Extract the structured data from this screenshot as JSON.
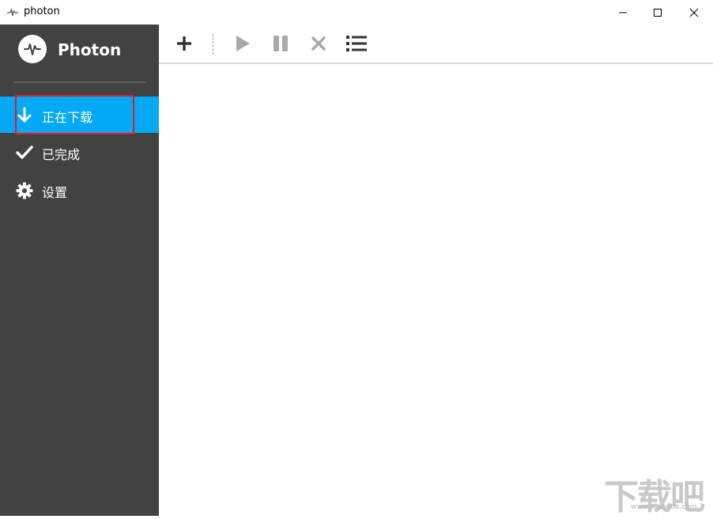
{
  "window": {
    "title": "photon"
  },
  "brand": {
    "name": "Photon",
    "icon": "pulse-icon"
  },
  "sidebar": {
    "items": [
      {
        "label": "正在下载",
        "icon": "arrow-down-icon",
        "active": true
      },
      {
        "label": "已完成",
        "icon": "check-icon",
        "active": false
      },
      {
        "label": "设置",
        "icon": "gear-icon",
        "active": false
      }
    ]
  },
  "toolbar": {
    "tools": [
      {
        "icon": "plus-icon",
        "enabled": true
      },
      {
        "icon": "play-icon",
        "enabled": false
      },
      {
        "icon": "pause-icon",
        "enabled": false
      },
      {
        "icon": "close-icon",
        "enabled": false
      },
      {
        "icon": "list-icon",
        "enabled": true
      }
    ]
  },
  "colors": {
    "sidebar_bg": "#424242",
    "accent": "#03a9f4",
    "highlight_border": "#e01b22",
    "tool_enabled": "#333333",
    "tool_disabled": "#a9a9a9"
  },
  "watermark": {
    "text": "下载吧",
    "url": "www.xiazaiba.com"
  }
}
